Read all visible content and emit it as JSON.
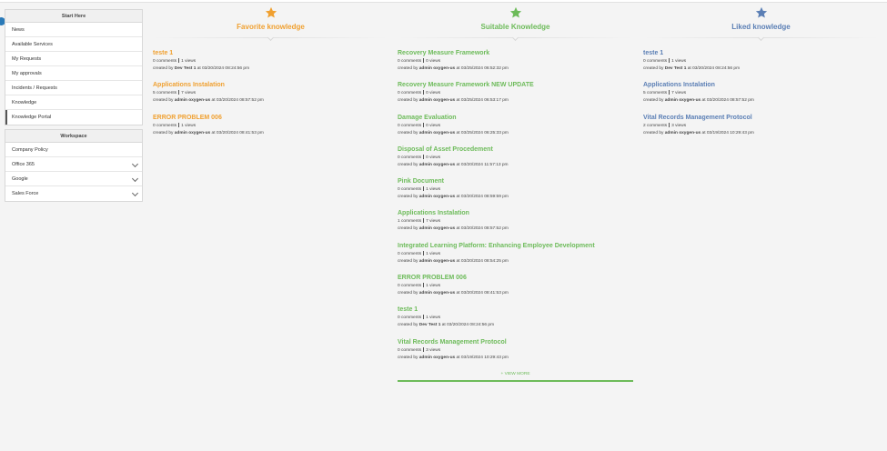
{
  "colors": {
    "orange": "#f0a030",
    "green": "#6dbb5a",
    "blue": "#5b7fb5"
  },
  "sidebar": {
    "start_here": {
      "title": "Start Here",
      "items": [
        {
          "label": "News"
        },
        {
          "label": "Available Services"
        },
        {
          "label": "My Requests"
        },
        {
          "label": "My approvals"
        },
        {
          "label": "Incidents / Requests"
        },
        {
          "label": "Knowledge"
        },
        {
          "label": "Knowledge Portal"
        }
      ]
    },
    "workspace": {
      "title": "Workspace",
      "items": [
        {
          "label": "Company Policy"
        },
        {
          "label": "Office 365"
        },
        {
          "label": "Google"
        },
        {
          "label": "Sales Force"
        }
      ]
    }
  },
  "columns": {
    "favorite": {
      "title": "Favorite knowledge",
      "icon": "star-icon",
      "articles": [
        {
          "title": "teste 1",
          "comments": "0 comments",
          "views": "1 views",
          "created_prefix": "created by",
          "author": "Dev Test 1",
          "date": "at 03/20/2024 08:24:56 pm"
        },
        {
          "title": "Applications Instalation",
          "comments": "5 comments",
          "views": "7 views",
          "created_prefix": "created by",
          "author": "admin oxygen-us",
          "date": "at 03/20/2024 08:57:52 pm"
        },
        {
          "title": "ERROR PROBLEM 006",
          "comments": "0 comments",
          "views": "1 views",
          "created_prefix": "created by",
          "author": "admin oxygen-us",
          "date": "at 03/20/2024 08:41:53 pm"
        }
      ]
    },
    "suitable": {
      "title": "Suitable Knowledge",
      "icon": "star-icon",
      "articles": [
        {
          "title": "Recovery Measure Framework",
          "comments": "0 comments",
          "views": "0 views",
          "created_prefix": "created by",
          "author": "admin oxygen-us",
          "date": "at 03/25/2024 06:52:32 pm"
        },
        {
          "title": "Recovery Measure Framework NEW UPDATE",
          "comments": "0 comments",
          "views": "0 views",
          "created_prefix": "created by",
          "author": "admin oxygen-us",
          "date": "at 03/25/2024 06:53:17 pm"
        },
        {
          "title": "Damage Evaluation",
          "comments": "0 comments",
          "views": "0 views",
          "created_prefix": "created by",
          "author": "admin oxygen-us",
          "date": "at 03/25/2024 06:25:33 pm"
        },
        {
          "title": "Disposal of Asset Procedement",
          "comments": "0 comments",
          "views": "0 views",
          "created_prefix": "created by",
          "author": "admin oxygen-us",
          "date": "at 03/20/2024 11:57:13 pm"
        },
        {
          "title": "Pink Document",
          "comments": "0 comments",
          "views": "1 views",
          "created_prefix": "created by",
          "author": "admin oxygen-us",
          "date": "at 03/20/2024 08:59:59 pm"
        },
        {
          "title": "Applications Instalation",
          "comments": "1 comments",
          "views": "7 views",
          "created_prefix": "created by",
          "author": "admin oxygen-us",
          "date": "at 03/20/2024 08:57:52 pm"
        },
        {
          "title": "Integrated Learning Platform: Enhancing Employee Development",
          "comments": "0 comments",
          "views": "1 views",
          "created_prefix": "created by",
          "author": "admin oxygen-us",
          "date": "at 03/20/2024 08:54:25 pm"
        },
        {
          "title": "ERROR PROBLEM 006",
          "comments": "0 comments",
          "views": "1 views",
          "created_prefix": "created by",
          "author": "admin oxygen-us",
          "date": "at 03/20/2024 08:41:53 pm"
        },
        {
          "title": "teste 1",
          "comments": "0 comments",
          "views": "1 views",
          "created_prefix": "created by",
          "author": "Dev Test 1",
          "date": "at 03/20/2024 08:24:56 pm"
        },
        {
          "title": "Vital Records Management Protocol",
          "comments": "0 comments",
          "views": "3 views",
          "created_prefix": "created by",
          "author": "admin oxygen-us",
          "date": "at 03/19/2024 10:29:43 pm"
        }
      ],
      "view_more": "+ VIEW MORE"
    },
    "liked": {
      "title": "Liked knowledge",
      "icon": "star-icon",
      "articles": [
        {
          "title": "teste 1",
          "comments": "0 comments",
          "views": "1 views",
          "created_prefix": "created by",
          "author": "Dev Test 1",
          "date": "at 03/20/2024 08:24:56 pm"
        },
        {
          "title": "Applications Instalation",
          "comments": "5 comments",
          "views": "7 views",
          "created_prefix": "created by",
          "author": "admin oxygen-us",
          "date": "at 03/20/2024 08:57:52 pm"
        },
        {
          "title": "Vital Records Management Protocol",
          "comments": "2 comments",
          "views": "3 views",
          "created_prefix": "created by",
          "author": "admin oxygen-us",
          "date": "at 03/19/2024 10:29:43 pm"
        }
      ]
    }
  }
}
